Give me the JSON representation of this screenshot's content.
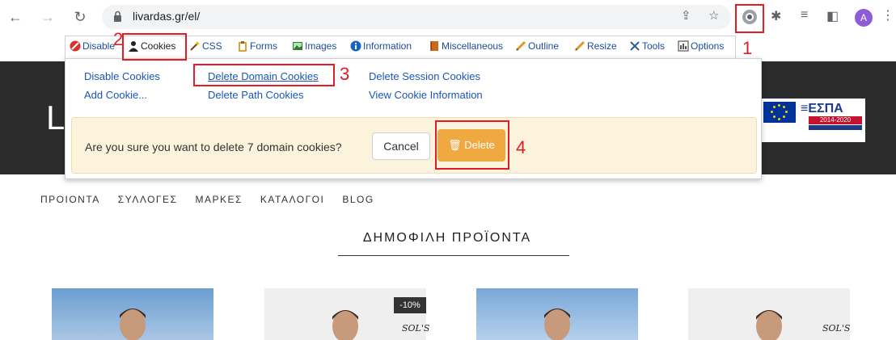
{
  "browser": {
    "url": "livardas.gr/el/",
    "avatar_letter": "A",
    "accent": "#8e5cd9"
  },
  "webdev_toolbar": {
    "items": [
      {
        "label": "Disable",
        "icon": "no-entry-icon"
      },
      {
        "label": "Cookies",
        "icon": "person-icon"
      },
      {
        "label": "CSS",
        "icon": "wand-icon"
      },
      {
        "label": "Forms",
        "icon": "clipboard-icon"
      },
      {
        "label": "Images",
        "icon": "image-icon"
      },
      {
        "label": "Information",
        "icon": "info-icon"
      },
      {
        "label": "Miscellaneous",
        "icon": "book-icon"
      },
      {
        "label": "Outline",
        "icon": "pencil-icon"
      },
      {
        "label": "Resize",
        "icon": "pencil-icon"
      },
      {
        "label": "Tools",
        "icon": "tools-icon"
      },
      {
        "label": "Options",
        "icon": "options-icon"
      }
    ]
  },
  "cookies_menu": {
    "col1": [
      "Disable Cookies",
      "Add Cookie..."
    ],
    "col2": [
      "Delete Domain Cookies",
      "Delete Path Cookies"
    ],
    "col3": [
      "Delete Session Cookies",
      "View Cookie Information"
    ]
  },
  "confirm": {
    "message": "Are you sure you want to delete 7 domain cookies?",
    "cancel": "Cancel",
    "delete": "Delete"
  },
  "annotations": [
    "1",
    "2",
    "3",
    "4"
  ],
  "site": {
    "logo_letter": "L",
    "espa_title": "≡ΕΣΠΑ",
    "espa_years": "2014-2020",
    "nav": [
      "ΠΡΟΙΟΝΤΑ",
      "ΣΥΛΛΟΓΕΣ",
      "ΜΑΡΚΕΣ",
      "ΚΑΤΑΛΟΓΟΙ",
      "BLOG"
    ],
    "section_title": "ΔΗΜΟΦΙΛΗ ΠΡΟΪΟΝΤΑ",
    "discount": "-10%",
    "brand": "SOL'S"
  }
}
